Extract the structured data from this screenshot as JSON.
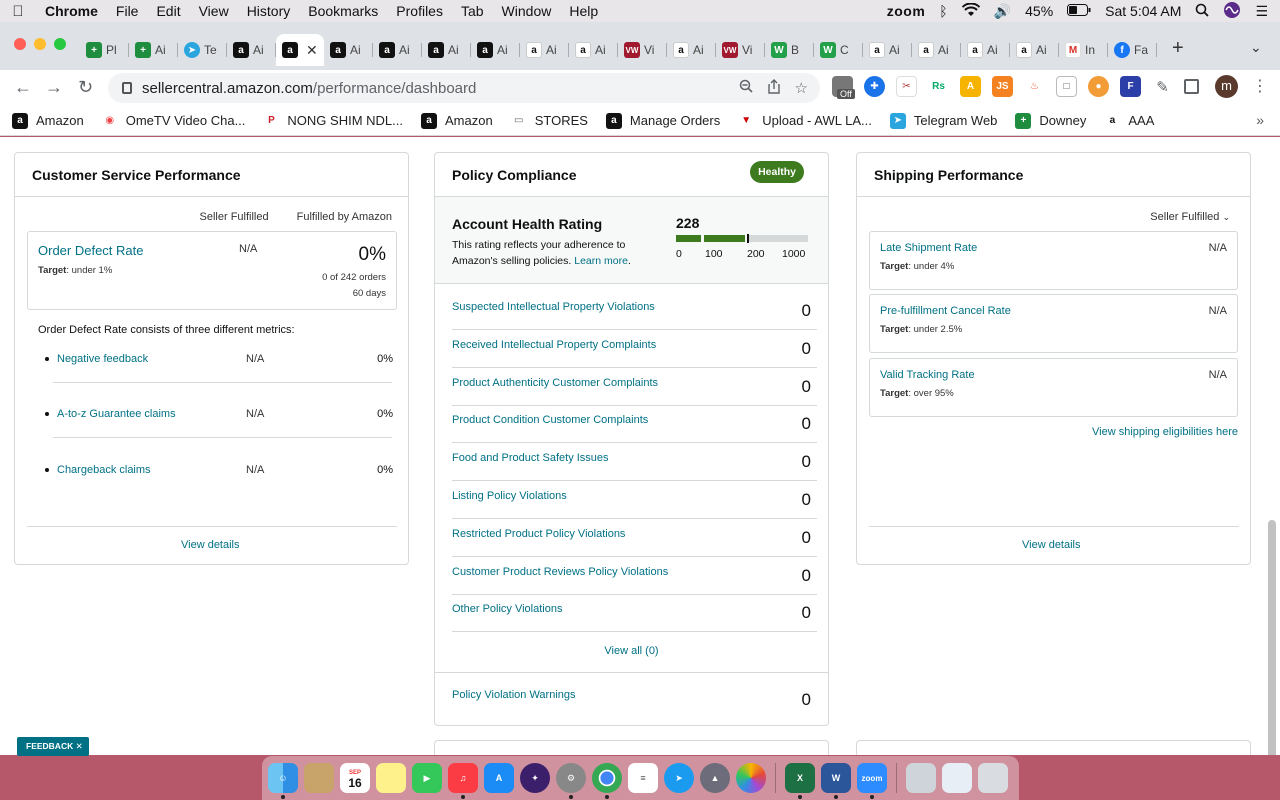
{
  "menubar": {
    "app": "Chrome",
    "items": [
      "File",
      "Edit",
      "View",
      "History",
      "Bookmarks",
      "Profiles",
      "Tab",
      "Window",
      "Help"
    ],
    "zoom": "zoom",
    "battery": "45%",
    "clock": "Sat 5:04 AM"
  },
  "tabs": [
    {
      "label": "Pl",
      "icon": "sheets-icon",
      "kind": "grn"
    },
    {
      "label": "Ai",
      "icon": "sheets-icon",
      "kind": "grn"
    },
    {
      "label": "Te",
      "icon": "telegram-icon",
      "kind": "tg"
    },
    {
      "label": "Ai",
      "icon": "amazon-icon",
      "kind": "amz"
    },
    {
      "label": "",
      "icon": "amazon-icon",
      "kind": "amz",
      "active": true
    },
    {
      "label": "Ai",
      "icon": "amazon-icon",
      "kind": "amz"
    },
    {
      "label": "Ai",
      "icon": "amazon-icon",
      "kind": "amz"
    },
    {
      "label": "Ai",
      "icon": "amazon-icon",
      "kind": "amz"
    },
    {
      "label": "Ai",
      "icon": "amazon-icon",
      "kind": "amz"
    },
    {
      "label": "Ai",
      "icon": "amazon-smile-icon",
      "kind": "amzw"
    },
    {
      "label": "Ai",
      "icon": "amazon-smile-icon",
      "kind": "amzw"
    },
    {
      "label": "Vi",
      "icon": "vw-icon",
      "kind": "vw"
    },
    {
      "label": "Ai",
      "icon": "amazon-smile-icon",
      "kind": "amzw"
    },
    {
      "label": "Vi",
      "icon": "vw-icon",
      "kind": "vw"
    },
    {
      "label": "B",
      "icon": "w-icon",
      "kind": "w"
    },
    {
      "label": "C",
      "icon": "w-icon",
      "kind": "w"
    },
    {
      "label": "Ai",
      "icon": "amazon-smile-icon",
      "kind": "amzw"
    },
    {
      "label": "Ai",
      "icon": "amazon-smile-icon",
      "kind": "amzw"
    },
    {
      "label": "Ai",
      "icon": "amazon-smile-icon",
      "kind": "amzw"
    },
    {
      "label": "Ai",
      "icon": "amazon-smile-icon",
      "kind": "amzw"
    },
    {
      "label": "In",
      "icon": "gmail-icon",
      "kind": "gm"
    },
    {
      "label": "Fa",
      "icon": "facebook-icon",
      "kind": "fb"
    }
  ],
  "url": {
    "host": "sellercentral.amazon.com",
    "path": "/performance/dashboard"
  },
  "extensions": {
    "off_badge": "Off"
  },
  "profile": {
    "initial": "m"
  },
  "bookmarks": [
    {
      "label": "Amazon",
      "icon": "amazon-icon"
    },
    {
      "label": "OmeTV Video Cha...",
      "icon": "ometv-icon"
    },
    {
      "label": "NONG SHIM NDL...",
      "icon": "pinterest-icon"
    },
    {
      "label": "Amazon",
      "icon": "amazon-icon"
    },
    {
      "label": "STORES",
      "icon": "folder-icon"
    },
    {
      "label": "Manage Orders",
      "icon": "amazon-icon"
    },
    {
      "label": "Upload - AWL LA...",
      "icon": "awl-icon"
    },
    {
      "label": "Telegram Web",
      "icon": "telegram-icon"
    },
    {
      "label": "Downey",
      "icon": "sheets-icon"
    },
    {
      "label": "AAA",
      "icon": "amazon-smile-icon"
    }
  ],
  "customer_service": {
    "title": "Customer Service Performance",
    "col_seller": "Seller Fulfilled",
    "col_fba": "Fulfilled by Amazon",
    "odr_label": "Order Defect Rate",
    "odr_target_label": "Target",
    "odr_target": ": under 1%",
    "odr_sf": "N/A",
    "odr_value": "0%",
    "odr_orders": "0 of 242 orders",
    "odr_days": "60 days",
    "desc": "Order Defect Rate consists of three different metrics:",
    "metrics": [
      {
        "label": "Negative feedback",
        "sf": "N/A",
        "fba": "0%"
      },
      {
        "label": "A-to-z Guarantee claims",
        "sf": "N/A",
        "fba": "0%"
      },
      {
        "label": "Chargeback claims",
        "sf": "N/A",
        "fba": "0%"
      }
    ],
    "view_details": "View details"
  },
  "policy": {
    "title": "Policy Compliance",
    "badge": "Healthy",
    "ahr_title": "Account Health Rating",
    "ahr_desc": "This rating reflects your adherence to Amazon's selling policies.",
    "ahr_learn": "Learn more",
    "ahr_score": "228",
    "ahr_ticks": [
      "0",
      "100",
      "200",
      "1000"
    ],
    "violations": [
      {
        "label": "Suspected Intellectual Property Violations",
        "value": "0"
      },
      {
        "label": "Received Intellectual Property Complaints",
        "value": "0"
      },
      {
        "label": "Product Authenticity Customer Complaints",
        "value": "0"
      },
      {
        "label": "Product Condition Customer Complaints",
        "value": "0"
      },
      {
        "label": "Food and Product Safety Issues",
        "value": "0"
      },
      {
        "label": "Listing Policy Violations",
        "value": "0"
      },
      {
        "label": "Restricted Product Policy Violations",
        "value": "0"
      },
      {
        "label": "Customer Product Reviews Policy Violations",
        "value": "0"
      },
      {
        "label": "Other Policy Violations",
        "value": "0"
      }
    ],
    "view_all": "View all (0)",
    "warnings_label": "Policy Violation Warnings",
    "warnings_value": "0"
  },
  "shipping": {
    "title": "Shipping Performance",
    "filter": "Seller Fulfilled",
    "metrics": [
      {
        "label": "Late Shipment Rate",
        "target_label": "Target",
        "target": ": under 4%",
        "value": "N/A"
      },
      {
        "label": "Pre-fulfillment Cancel Rate",
        "target_label": "Target",
        "target": ": under 2.5%",
        "value": "N/A"
      },
      {
        "label": "Valid Tracking Rate",
        "target_label": "Target",
        "target": ": over 95%",
        "value": "N/A"
      }
    ],
    "eligibilities": "View shipping eligibilities here",
    "view_details": "View details"
  },
  "feedback": "FEEDBACK",
  "dock": {
    "calendar_month": "SEP",
    "calendar_day": "16",
    "zoom_label": "zoom"
  },
  "colors": {
    "link": "#007185",
    "healthy": "#3e7a1e",
    "bar_green": "#3e7a1e",
    "bar_gray": "#d5d9d9"
  }
}
